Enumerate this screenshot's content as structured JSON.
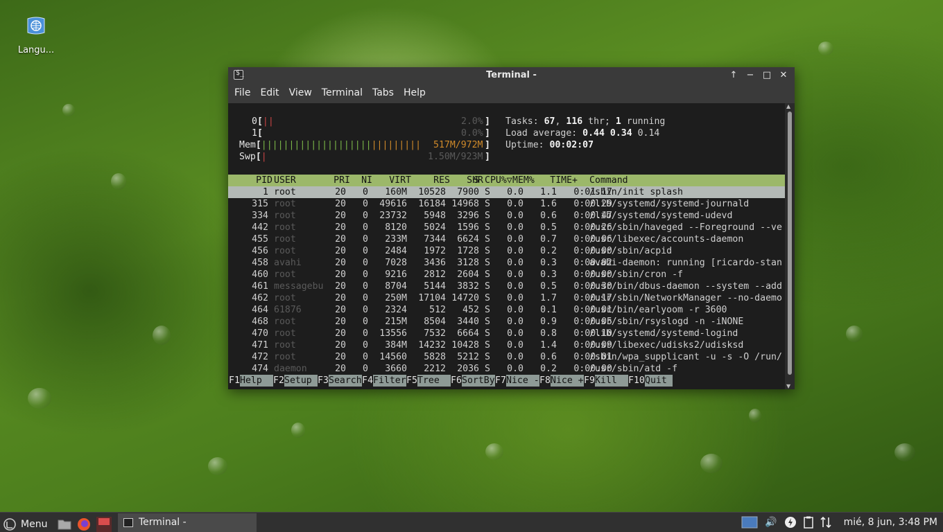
{
  "desktop": {
    "icon_label": "Langu..."
  },
  "window": {
    "title": "Terminal -"
  },
  "menubar": [
    "File",
    "Edit",
    "View",
    "Terminal",
    "Tabs",
    "Help"
  ],
  "meters": {
    "cpu0_label": "0",
    "cpu0_value": "2.0%",
    "cpu1_label": "1",
    "cpu1_value": "0.0%",
    "mem_label": "Mem",
    "mem_value": "517M/972M",
    "swp_label": "Swp",
    "swp_value": "1.50M/923M"
  },
  "summary": {
    "tasks_label": "Tasks:",
    "tasks": "67",
    "thr": "116",
    "thr_label": "thr;",
    "running": "1",
    "running_label": "running",
    "load_label": "Load average:",
    "load1": "0.44",
    "load5": "0.34",
    "load15": "0.14",
    "uptime_label": "Uptime:",
    "uptime": "00:02:07"
  },
  "columns": [
    "PID",
    "USER",
    "PRI",
    "NI",
    "VIRT",
    "RES",
    "SHR",
    "S",
    "CPU%▽",
    "MEM%",
    "TIME+",
    "Command"
  ],
  "processes": [
    {
      "pid": "1",
      "user": "root",
      "pri": "20",
      "ni": "0",
      "virt": "160M",
      "res": "10528",
      "shr": "7900",
      "s": "S",
      "cpu": "0.0",
      "mem": "1.1",
      "time": "0:01.17",
      "cmd": "/sbin/init splash"
    },
    {
      "pid": "315",
      "user": "root",
      "pri": "20",
      "ni": "0",
      "virt": "49616",
      "res": "16184",
      "shr": "14968",
      "s": "S",
      "cpu": "0.0",
      "mem": "1.6",
      "time": "0:00.29",
      "cmd": "/lib/systemd/systemd-journald"
    },
    {
      "pid": "334",
      "user": "root",
      "pri": "20",
      "ni": "0",
      "virt": "23732",
      "res": "5948",
      "shr": "3296",
      "s": "S",
      "cpu": "0.0",
      "mem": "0.6",
      "time": "0:00.47",
      "cmd": "/lib/systemd/systemd-udevd"
    },
    {
      "pid": "442",
      "user": "root",
      "pri": "20",
      "ni": "0",
      "virt": "8120",
      "res": "5024",
      "shr": "1596",
      "s": "S",
      "cpu": "0.0",
      "mem": "0.5",
      "time": "0:00.26",
      "cmd": "/usr/sbin/haveged --Foreground --ve"
    },
    {
      "pid": "455",
      "user": "root",
      "pri": "20",
      "ni": "0",
      "virt": "233M",
      "res": "7344",
      "shr": "6624",
      "s": "S",
      "cpu": "0.0",
      "mem": "0.7",
      "time": "0:00.06",
      "cmd": "/usr/libexec/accounts-daemon"
    },
    {
      "pid": "456",
      "user": "root",
      "pri": "20",
      "ni": "0",
      "virt": "2484",
      "res": "1972",
      "shr": "1728",
      "s": "S",
      "cpu": "0.0",
      "mem": "0.2",
      "time": "0:00.00",
      "cmd": "/usr/sbin/acpid"
    },
    {
      "pid": "458",
      "user": "avahi",
      "pri": "20",
      "ni": "0",
      "virt": "7028",
      "res": "3436",
      "shr": "3128",
      "s": "S",
      "cpu": "0.0",
      "mem": "0.3",
      "time": "0:00.02",
      "cmd": "avahi-daemon: running [ricardo-stan"
    },
    {
      "pid": "460",
      "user": "root",
      "pri": "20",
      "ni": "0",
      "virt": "9216",
      "res": "2812",
      "shr": "2604",
      "s": "S",
      "cpu": "0.0",
      "mem": "0.3",
      "time": "0:00.00",
      "cmd": "/usr/sbin/cron -f"
    },
    {
      "pid": "461",
      "user": "messagebu",
      "pri": "20",
      "ni": "0",
      "virt": "8704",
      "res": "5144",
      "shr": "3832",
      "s": "S",
      "cpu": "0.0",
      "mem": "0.5",
      "time": "0:00.30",
      "cmd": "/usr/bin/dbus-daemon --system --add"
    },
    {
      "pid": "462",
      "user": "root",
      "pri": "20",
      "ni": "0",
      "virt": "250M",
      "res": "17104",
      "shr": "14720",
      "s": "S",
      "cpu": "0.0",
      "mem": "1.7",
      "time": "0:00.17",
      "cmd": "/usr/sbin/NetworkManager --no-daemo"
    },
    {
      "pid": "464",
      "user": "61876",
      "pri": "20",
      "ni": "0",
      "virt": "2324",
      "res": "512",
      "shr": "452",
      "s": "S",
      "cpu": "0.0",
      "mem": "0.1",
      "time": "0:00.01",
      "cmd": "/usr/bin/earlyoom -r 3600"
    },
    {
      "pid": "468",
      "user": "root",
      "pri": "20",
      "ni": "0",
      "virt": "215M",
      "res": "8504",
      "shr": "3440",
      "s": "S",
      "cpu": "0.0",
      "mem": "0.9",
      "time": "0:00.05",
      "cmd": "/usr/sbin/rsyslogd -n -iNONE"
    },
    {
      "pid": "470",
      "user": "root",
      "pri": "20",
      "ni": "0",
      "virt": "13556",
      "res": "7532",
      "shr": "6664",
      "s": "S",
      "cpu": "0.0",
      "mem": "0.8",
      "time": "0:00.10",
      "cmd": "/lib/systemd/systemd-logind"
    },
    {
      "pid": "471",
      "user": "root",
      "pri": "20",
      "ni": "0",
      "virt": "384M",
      "res": "14232",
      "shr": "10428",
      "s": "S",
      "cpu": "0.0",
      "mem": "1.4",
      "time": "0:00.09",
      "cmd": "/usr/libexec/udisks2/udisksd"
    },
    {
      "pid": "472",
      "user": "root",
      "pri": "20",
      "ni": "0",
      "virt": "14560",
      "res": "5828",
      "shr": "5212",
      "s": "S",
      "cpu": "0.0",
      "mem": "0.6",
      "time": "0:00.01",
      "cmd": "/sbin/wpa_supplicant -u -s -O /run/"
    },
    {
      "pid": "474",
      "user": "daemon",
      "pri": "20",
      "ni": "0",
      "virt": "3660",
      "res": "2212",
      "shr": "2036",
      "s": "S",
      "cpu": "0.0",
      "mem": "0.2",
      "time": "0:00.00",
      "cmd": "/usr/sbin/atd -f"
    }
  ],
  "fkeys": [
    {
      "key": "F1",
      "label": "Help"
    },
    {
      "key": "F2",
      "label": "Setup"
    },
    {
      "key": "F3",
      "label": "Search"
    },
    {
      "key": "F4",
      "label": "Filter"
    },
    {
      "key": "F5",
      "label": "Tree"
    },
    {
      "key": "F6",
      "label": "SortBy"
    },
    {
      "key": "F7",
      "label": "Nice -"
    },
    {
      "key": "F8",
      "label": "Nice +"
    },
    {
      "key": "F9",
      "label": "Kill"
    },
    {
      "key": "F10",
      "label": "Quit"
    }
  ],
  "taskbar": {
    "menu_label": "Menu",
    "task_label": "Terminal -",
    "clock": "mié,  8 jun,  3:48 PM"
  },
  "colors": {
    "header_bg": "#9cb86a",
    "selected_bg": "#b3b9b6",
    "fkey_bg": "#8e9a96"
  }
}
